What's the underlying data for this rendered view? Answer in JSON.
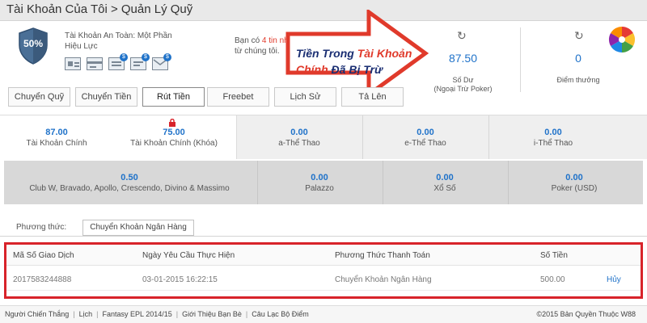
{
  "title": "Tài Khoản Của Tôi > Quản Lý Quỹ",
  "security": {
    "percent": "50%",
    "line1": "Tài Khoản An Toàn: Một Phần",
    "line2": "Hiệu Lực"
  },
  "message": {
    "prefix": "Bạn có ",
    "highlight": "4 tin nh",
    "line2": "từ chúng tôi."
  },
  "callout": {
    "part1": "Tiền Trong ",
    "part2": "Tài Khoản",
    "part3": "Chính",
    "part4": " Đã Bị Trừ",
    "arrow_color": "#e03a2b"
  },
  "balance": {
    "value": "87.50",
    "label_line1": "Số Dư",
    "label_line2": "(Ngoại Trừ Poker)"
  },
  "points": {
    "value": "0",
    "label": "Điểm thưởng"
  },
  "tabs": [
    {
      "label": "Chuyển Quỹ"
    },
    {
      "label": "Chuyển Tiền"
    },
    {
      "label": "Rút Tiền"
    },
    {
      "label": "Freebet"
    },
    {
      "label": "Lịch Sử"
    },
    {
      "label": "Tả  Lên"
    }
  ],
  "accounts_row1": [
    {
      "value": "87.00",
      "label": "Tài Khoản Chính"
    },
    {
      "value": "75.00",
      "label": "Tài Khoản Chính (Khóa)"
    },
    {
      "value": "0.00",
      "label": "a-Thể Thao"
    },
    {
      "value": "0.00",
      "label": "e-Thể Thao"
    },
    {
      "value": "0.00",
      "label": "i-Thể Thao"
    }
  ],
  "accounts_row2": [
    {
      "value": "0.50",
      "label": "Club W, Bravado, Apollo, Crescendo, Divino & Massimo"
    },
    {
      "value": "0.00",
      "label": "Palazzo"
    },
    {
      "value": "0.00",
      "label": "Xổ Số"
    },
    {
      "value": "0.00",
      "label": "Poker (USD)"
    }
  ],
  "method": {
    "label": "Phương thức:",
    "value": "Chuyển Khoản Ngân Hàng"
  },
  "transactions": {
    "headers": [
      "Mã Số Giao Dịch",
      "Ngày Yêu Cầu Thực Hiện",
      "Phương Thức Thanh Toán",
      "Số Tiền"
    ],
    "rows": [
      {
        "id": "2017583244888",
        "date": "03-01-2015 16:22:15",
        "method": "Chuyển Khoản Ngân Hàng",
        "amount": "500.00",
        "action": "Hủy"
      }
    ]
  },
  "footer": {
    "links": [
      "Người Chiến Thắng",
      "Lịch",
      "Fantasy EPL 2014/15",
      "Giới Thiệu Bạn Bè",
      "Câu Lạc Bộ Điểm"
    ],
    "copyright": "©2015 Bản Quyền Thuộc W88"
  },
  "colors": {
    "accent": "#1f72c9",
    "highlight_border": "#d8232a",
    "shield": "#4a6f96"
  }
}
